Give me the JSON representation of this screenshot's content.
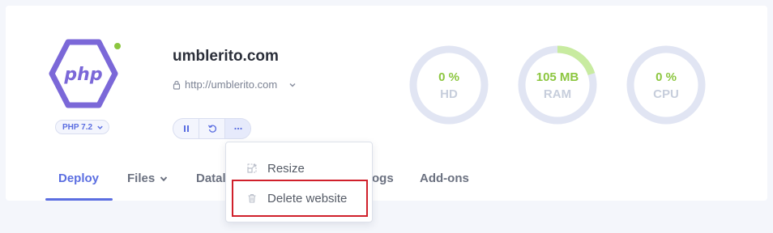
{
  "app": {
    "runtime_logo_text": "php",
    "runtime_version": "PHP 7.2",
    "status_color": "#8cc63f",
    "brand_color": "#7b68d8",
    "accent_color": "#5b6ee1"
  },
  "site": {
    "title": "umblerito.com",
    "url": "http://umblerito.com"
  },
  "actions": [
    {
      "icon": "pause-icon"
    },
    {
      "icon": "restart-icon"
    },
    {
      "icon": "more-icon"
    }
  ],
  "gauges": [
    {
      "value": "0 %",
      "label": "HD",
      "percent": 0
    },
    {
      "value": "105 MB",
      "label": "RAM",
      "percent": 20
    },
    {
      "value": "0 %",
      "label": "CPU",
      "percent": 0
    }
  ],
  "tabs": [
    {
      "label": "Deploy",
      "active": true
    },
    {
      "label": "Files",
      "has_dropdown": true
    },
    {
      "label": "Datal"
    },
    {
      "label": "ogs"
    },
    {
      "label": "Add-ons"
    }
  ],
  "menu": {
    "items": [
      {
        "label": "Resize",
        "icon": "resize-icon"
      },
      {
        "label": "Delete website",
        "icon": "trash-icon"
      }
    ]
  }
}
